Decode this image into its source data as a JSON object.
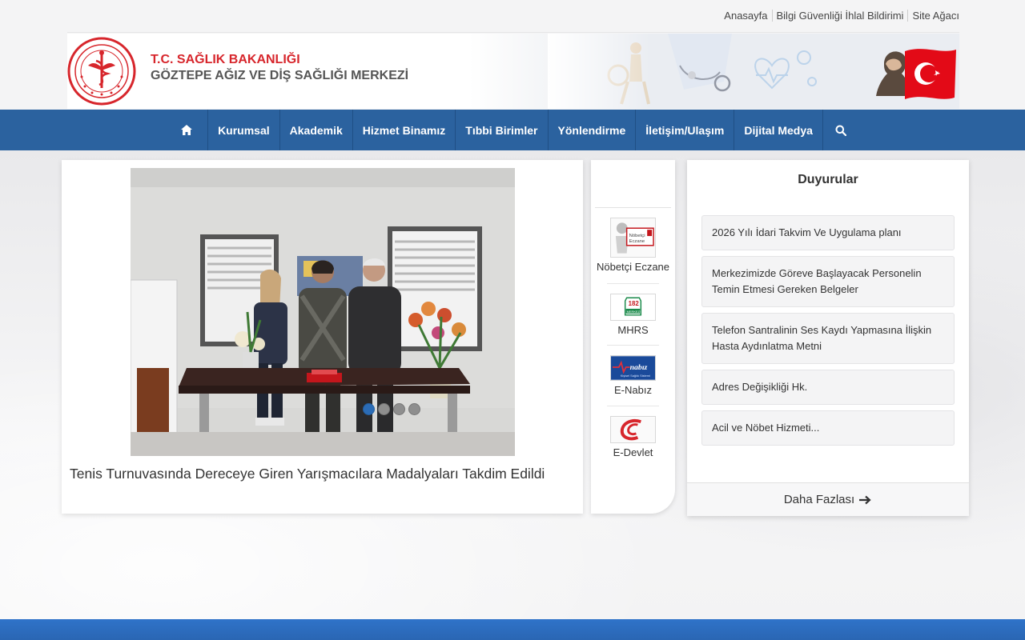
{
  "top_links": [
    "Anasayfa",
    "Bilgi Güvenliği İhlal Bildirimi",
    "Site Ağacı"
  ],
  "header": {
    "title_line1": "T.C. SAĞLIK BAKANLIĞI",
    "title_line2": "GÖZTEPE AĞIZ VE DİŞ SAĞLIĞI MERKEZİ"
  },
  "nav": {
    "items": [
      "Kurumsal",
      "Akademik",
      "Hizmet Binamız",
      "Tıbbi Birimler",
      "Yönlendirme",
      "İletişim/Ulaşım",
      "Dijital Medya"
    ]
  },
  "slider": {
    "caption": "Tenis Turnuvasında Dereceye Giren Yarışmacılara Madalyaları Takdim Edildi",
    "dots": 4,
    "active_dot": 1
  },
  "quick_links": [
    {
      "label": "Nöbetçi Eczane",
      "icon": "pharmacy-icon"
    },
    {
      "label": "MHRS",
      "icon": "mhrs-icon"
    },
    {
      "label": "E-Nabız",
      "icon": "enabiz-icon"
    },
    {
      "label": "E-Devlet",
      "icon": "edevlet-icon"
    }
  ],
  "announcements": {
    "title": "Duyurular",
    "items": [
      "2026 Yılı İdari Takvim Ve Uygulama planı",
      "Merkezimizde Göreve Başlayacak Personelin Temin Etmesi Gereken Belgeler",
      "Telefon Santralinin Ses Kaydı Yapmasına İlişkin Hasta Aydınlatma Metni",
      "Adres Değişikliği Hk.",
      "Acil ve Nöbet Hizmeti..."
    ],
    "more_label": "Daha Fazlası"
  },
  "colors": {
    "nav": "#2b629f",
    "brand_red": "#d7262c",
    "footer": "#2f73c9"
  }
}
